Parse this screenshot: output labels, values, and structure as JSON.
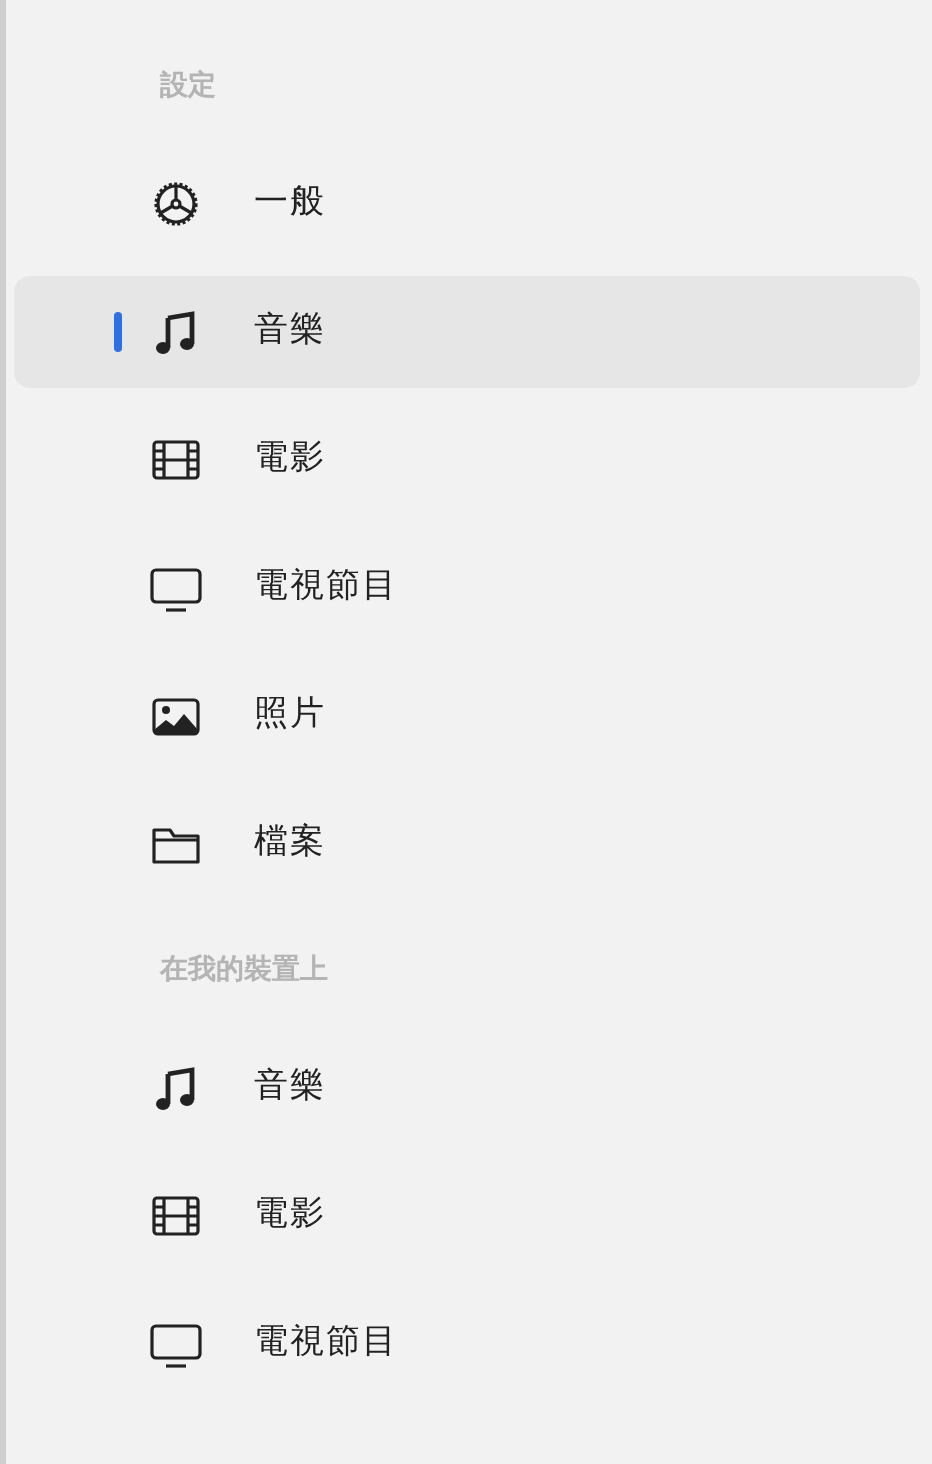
{
  "sections": [
    {
      "title": "設定",
      "items": [
        {
          "kind": "gear",
          "label": "一般",
          "selected": false
        },
        {
          "kind": "note",
          "label": "音樂",
          "selected": true
        },
        {
          "kind": "film",
          "label": "電影",
          "selected": false
        },
        {
          "kind": "tv",
          "label": "電視節目",
          "selected": false
        },
        {
          "kind": "photo",
          "label": "照片",
          "selected": false
        },
        {
          "kind": "folder",
          "label": "檔案",
          "selected": false
        }
      ]
    },
    {
      "title": "在我的裝置上",
      "items": [
        {
          "kind": "note",
          "label": "音樂",
          "selected": false
        },
        {
          "kind": "film",
          "label": "電影",
          "selected": false
        },
        {
          "kind": "tv",
          "label": "電視節目",
          "selected": false
        }
      ]
    }
  ]
}
